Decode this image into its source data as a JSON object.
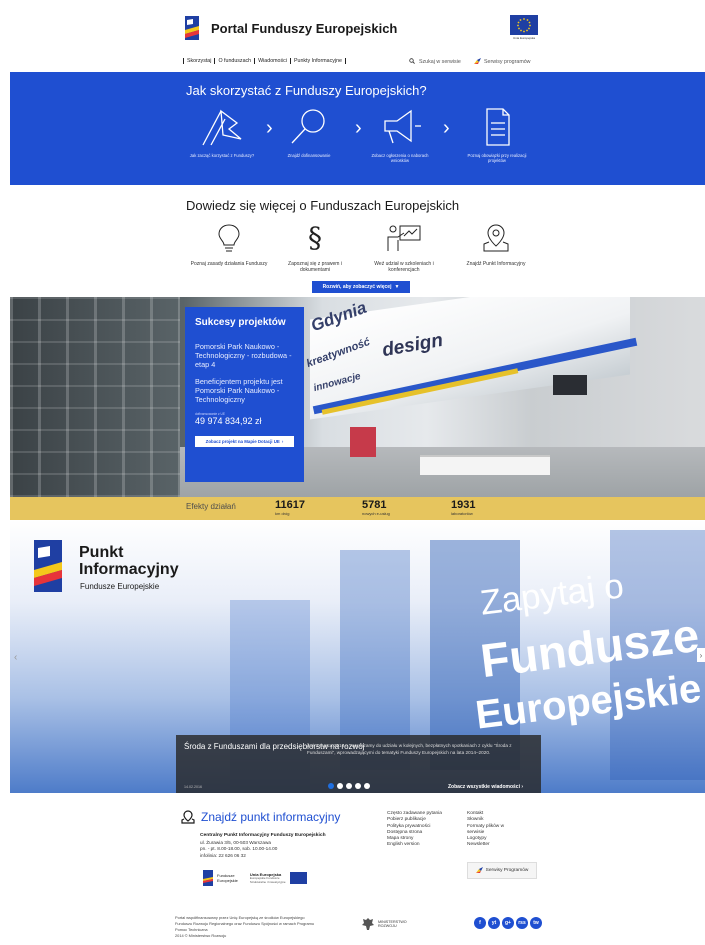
{
  "header": {
    "title": "Portal Funduszy Europejskich",
    "eu_caption": "Unia Europejska",
    "nav": [
      "Skorzystaj",
      "O funduszach",
      "Wiadomości",
      "Punkty Informacyjne"
    ],
    "search_label": "Szukaj w serwisie",
    "services_label": "Serwisy programów"
  },
  "steps": {
    "title": "Jak skorzystać z Funduszy Europejskich?",
    "items": [
      {
        "label": "Jak zacząć korzystać z Funduszy?",
        "icon": "flag-icon"
      },
      {
        "label": "Znajdź dofinansowanie",
        "icon": "magnifier-icon"
      },
      {
        "label": "Zobacz ogłoszenia o naborach wniosków",
        "icon": "megaphone-icon"
      },
      {
        "label": "Poznaj obowiązki przy realizacji projektów",
        "icon": "checklist-icon"
      }
    ]
  },
  "learn": {
    "title": "Dowiedz się więcej o Funduszach Europejskich",
    "items": [
      {
        "label": "Poznaj zasady działania Funduszy",
        "icon": "lightbulb-icon"
      },
      {
        "label": "Zapoznaj się z prawem i dokumentami",
        "icon": "paragraph-icon"
      },
      {
        "label": "Weź udział w szkoleniach i konferencjach",
        "icon": "presentation-icon"
      },
      {
        "label": "Znajdź Punkt Informacyjny",
        "icon": "map-pin-icon"
      }
    ],
    "expand_button": "Rozwiń, aby zobaczyć więcej"
  },
  "success": {
    "title": "Sukcesy projektów",
    "project": "Pomorski Park Naukowo - Technologiczny - rozbudowa - etap 4",
    "beneficiary": "Beneficjentem projektu jest Pomorski Park Naukowo - Technologiczny",
    "amount_caption": "dofinansowanie z UE",
    "amount": "49 974 834,92 zł",
    "button": "Zobacz projekt na Mapie Dotacji UE"
  },
  "photo_words": {
    "gdynia": "Gdynia",
    "kreatywnosc": "kreatywność",
    "innowacje": "innowacje",
    "design": "design"
  },
  "effects": {
    "label": "Efekty działań",
    "items": [
      {
        "value": "11617",
        "unit": "km dróg"
      },
      {
        "value": "5781",
        "unit": "nowych e-usług"
      },
      {
        "value": "1931",
        "unit": "laboratoriów"
      }
    ]
  },
  "hero": {
    "logo_title_1": "Punkt",
    "logo_title_2": "Informacyjny",
    "logo_subtitle": "Fundusze Europejskie",
    "big_1": "Zapytaj o",
    "big_2": "Fundusze",
    "big_3": "Europejskie",
    "news_title": "Środa z Funduszami dla przedsiębiorstw na rozwój",
    "news_text": "Już 2 marca 2016 r. zapraszamy do udziału w kolejnych, bezpłatnych spotkaniach z cyklu \"Środa z Funduszami\", wprowadzającymi do tematyki Funduszy Europejskich na lata 2014–2020.",
    "news_date": "14.02.2016",
    "all_news": "Zobacz wszystkie wiadomości",
    "slides_count": 5,
    "active_slide": 1
  },
  "footer": {
    "title": "Znajdź punkt informacyjny",
    "addr_name": "Centralny Punkt Informacyjny Funduszy Europejskich",
    "addr_street": "ul. Żurawia 3/5, 00-503 Warszawa",
    "addr_hours": "pn. - pt. 8.00-18.00, sob. 10.00-14.00",
    "addr_phone": "infolinia: 22 626 06 32",
    "links_1": [
      "Często zadawane pytania",
      "Pobierz publikacje",
      "Polityka prywatności",
      "Dostępna strona",
      "Mapa strony",
      "English version"
    ],
    "links_2": [
      "Kontakt",
      "Słownik",
      "Formaty plików w serwisie",
      "Logotypy",
      "Newsletter"
    ],
    "services_button": "Serwisy Programów",
    "fe_logo_1": "Fundusze",
    "fe_logo_2": "Europejskie",
    "eu_logo_1": "Unia Europejska",
    "eu_logo_2": "Europejskie Fundusze",
    "eu_logo_3": "Strukturalne i Inwestycyjne",
    "copy_1": "Portal współfinansowany przez Unię Europejską ze środków Europejskiego",
    "copy_2": "Funduszu Rozwoju Regionalnego oraz Funduszu Spójności w ramach Programu",
    "copy_3": "Pomoc Techniczna",
    "copy_4": "2014 © Ministerstwo Rozwoju",
    "ministry_1": "MINISTERSTWO",
    "ministry_2": "ROZWOJU",
    "social": [
      "f",
      "yt",
      "g+",
      "rss",
      "tw"
    ]
  },
  "colors": {
    "brand_blue": "#1f4fd1",
    "effects_yellow": "#e6c55e",
    "eu_blue": "#1f3fa3",
    "flag_red": "#e8343a",
    "flag_yellow": "#f4c81b"
  }
}
